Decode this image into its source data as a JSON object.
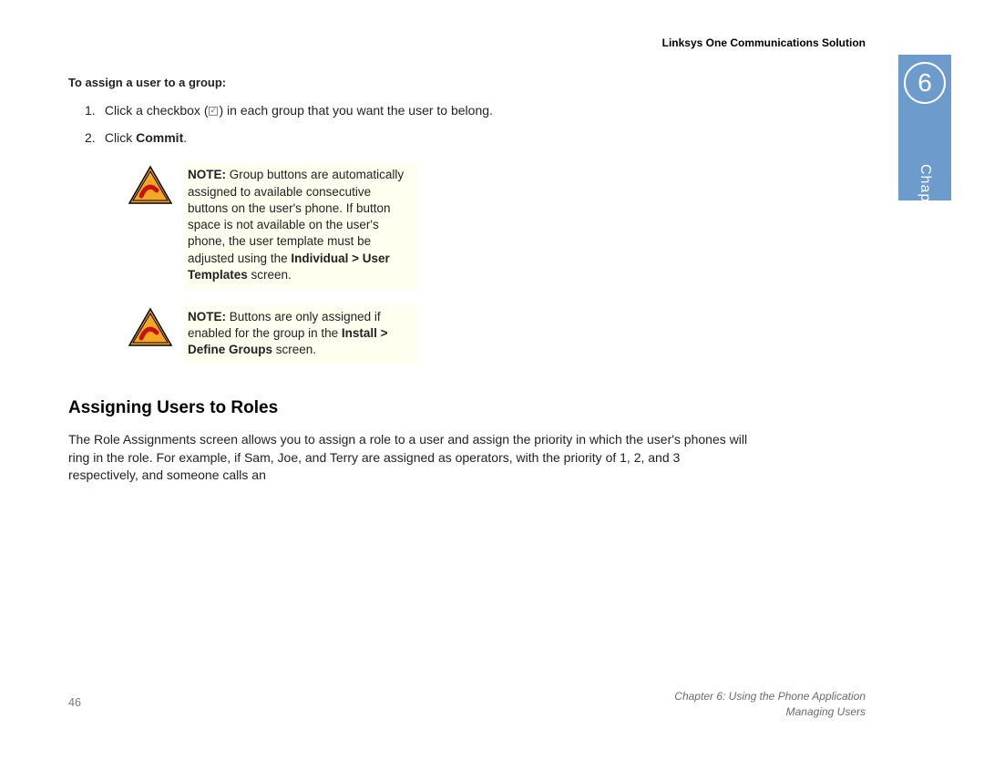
{
  "header": {
    "title": "Linksys One Communications Solution"
  },
  "chapter_tab": {
    "number": "6",
    "label": "Chapter"
  },
  "content": {
    "sub_heading": "To assign a user to a group:",
    "step1_prefix": "Click a checkbox (",
    "step1_suffix": ") in each group that you want the user to belong.",
    "step2_prefix": "Click ",
    "step2_bold": "Commit",
    "step2_suffix": ".",
    "note1": {
      "label": "NOTE:",
      "text_a": " Group buttons are automatically assigned to available consecutive buttons on the user's phone. If button space is not available on the user's phone, the user template must be adjusted using the ",
      "bold_a": "Individual > User Templates",
      "text_b": " screen."
    },
    "note2": {
      "label": "NOTE:",
      "text_a": " Buttons are only assigned if enabled for the group in the ",
      "bold_a": "Install > Define Groups",
      "text_b": " screen."
    },
    "section_heading": "Assigning Users to Roles",
    "body": "The Role Assignments screen allows you to assign a role to a user and assign the priority in which the user's phones will ring in the role. For example, if Sam, Joe, and Terry are assigned as operators, with the priority of 1, 2, and 3 respectively, and someone calls an"
  },
  "footer": {
    "page": "46",
    "chapter_line": "Chapter 6: Using the Phone Application",
    "sub_line": "Managing Users"
  }
}
